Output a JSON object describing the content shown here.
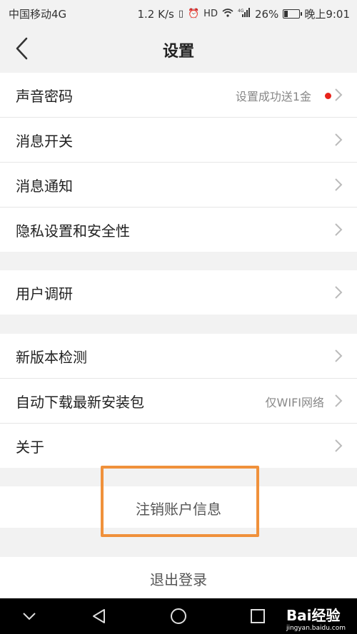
{
  "status": {
    "carrier": "中国移动4G",
    "speed": "1.2 K/s",
    "network": "4G",
    "battery": "26%",
    "battery_level": 0.26,
    "time": "晚上9:01"
  },
  "header": {
    "title": "设置"
  },
  "groups": [
    {
      "items": [
        {
          "label": "声音密码",
          "value": "设置成功送1金",
          "dot": true
        },
        {
          "label": "消息开关"
        },
        {
          "label": "消息通知"
        },
        {
          "label": "隐私设置和安全性"
        }
      ]
    },
    {
      "items": [
        {
          "label": "用户调研"
        }
      ]
    },
    {
      "items": [
        {
          "label": "新版本检测"
        },
        {
          "label": "自动下载最新安装包",
          "value": "仅WIFI网络"
        },
        {
          "label": "关于"
        }
      ]
    }
  ],
  "actions": {
    "deregister": "注销账户信息",
    "logout": "退出登录"
  },
  "watermark": {
    "brand": "Bai经验",
    "site": "jingyan.baidu.com"
  },
  "colors": {
    "highlight": "#f0913b",
    "red_dot": "#e8231b"
  }
}
